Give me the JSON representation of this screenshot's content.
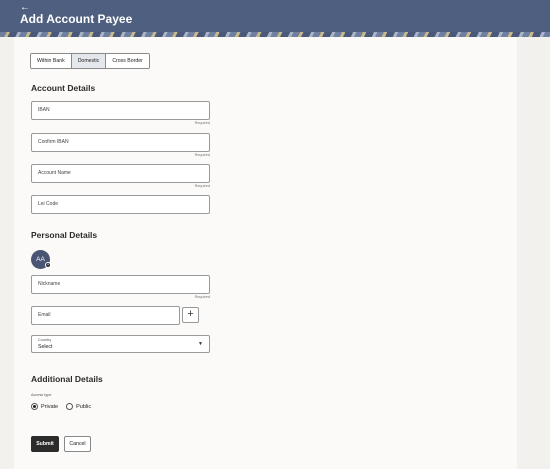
{
  "header": {
    "back_icon": "back-arrow-icon",
    "title": "Add Account Payee",
    "color": "#4f5f7f"
  },
  "tabs": [
    {
      "label": "Within Bank"
    },
    {
      "label": "Domestic",
      "active": true
    },
    {
      "label": "Cross Border"
    }
  ],
  "account_details": {
    "title": "Account Details",
    "iban": {
      "placeholder": "IBAN",
      "hint": "Required"
    },
    "confirm_iban": {
      "placeholder": "Confirm IBAN",
      "hint": "Required"
    },
    "account_name": {
      "placeholder": "Account Name",
      "hint": "Required"
    },
    "lei_code": {
      "placeholder": "Lei Code"
    }
  },
  "personal_details": {
    "title": "Personal Details",
    "avatar_initials": "AA",
    "nickname": {
      "placeholder": "Nickname",
      "hint": "Required"
    },
    "email": {
      "placeholder": "Email"
    },
    "add_email_icon": "plus-icon",
    "country": {
      "label": "Country",
      "value": "Select"
    }
  },
  "additional_details": {
    "title": "Additional Details",
    "access_type_label": "Access type",
    "options": [
      {
        "label": "Private",
        "checked": true
      },
      {
        "label": "Public",
        "checked": false
      }
    ]
  },
  "actions": {
    "submit_label": "Submit",
    "cancel_label": "Cancel"
  }
}
